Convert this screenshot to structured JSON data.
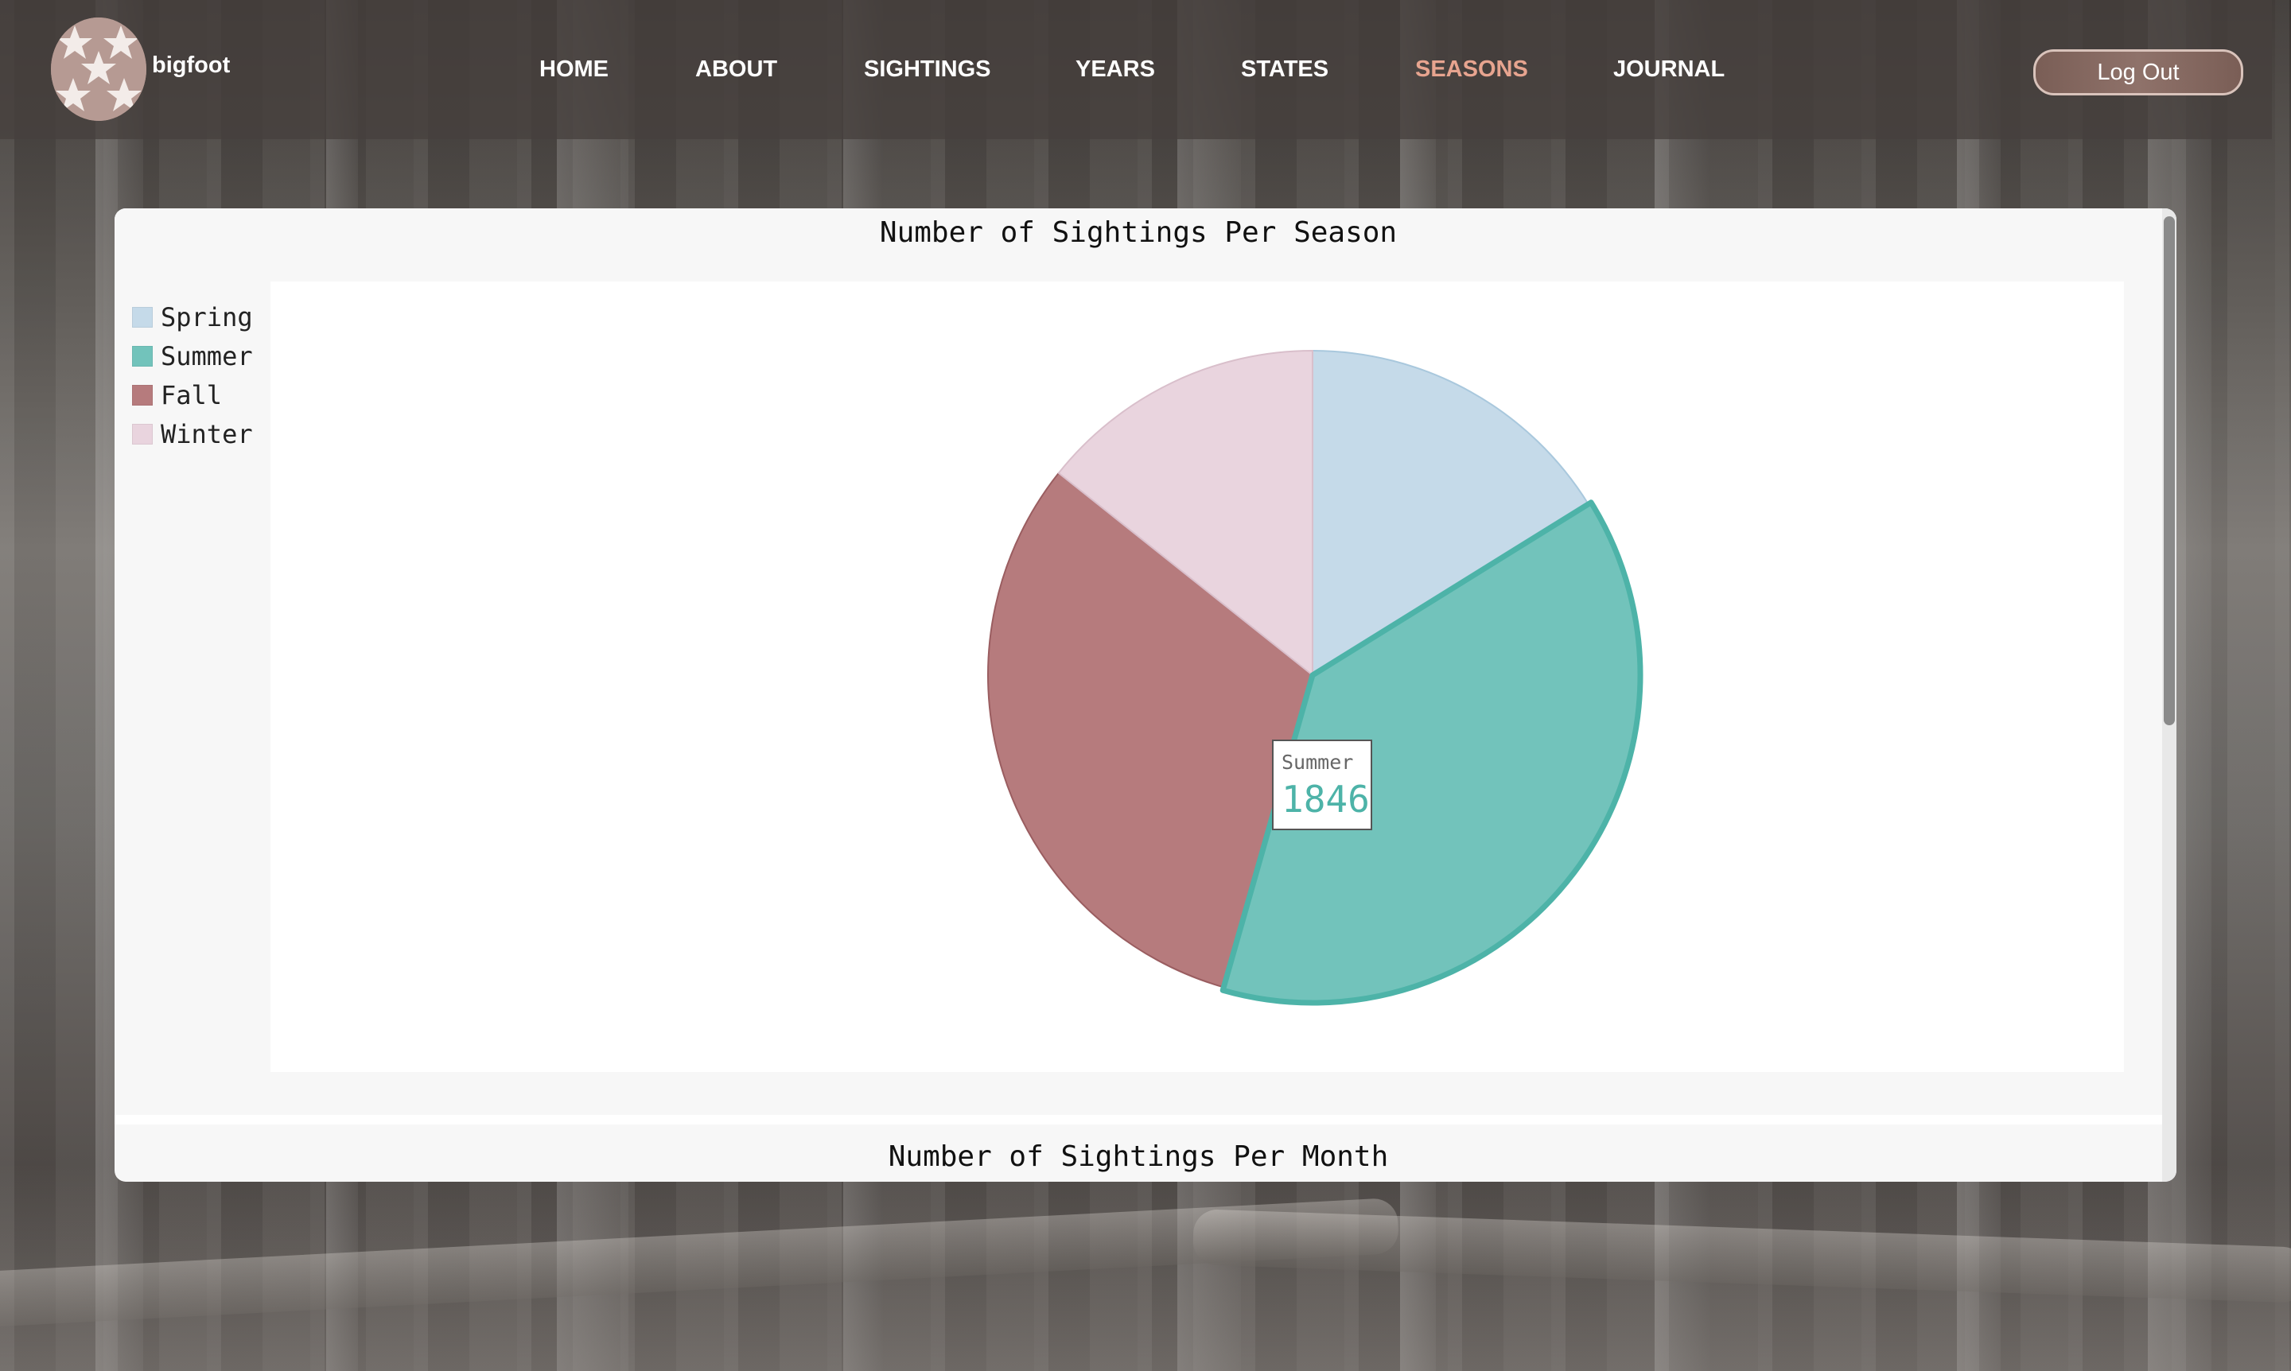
{
  "header": {
    "brand": "bigfoot",
    "logo_icon": "star-pattern-logo-icon",
    "nav": [
      {
        "label": "HOME",
        "active": false
      },
      {
        "label": "ABOUT",
        "active": false
      },
      {
        "label": "SIGHTINGS",
        "active": false
      },
      {
        "label": "YEARS",
        "active": false
      },
      {
        "label": "STATES",
        "active": false
      },
      {
        "label": "SEASONS",
        "active": true
      },
      {
        "label": "JOURNAL",
        "active": false
      }
    ],
    "logout_label": "Log Out"
  },
  "colors": {
    "active_nav": "#e7a48f",
    "spring": "#c5dae9",
    "summer": "#72c3bb",
    "fall": "#b67b7d",
    "winter": "#e9d4de"
  },
  "main": {
    "chart_title": "Number of Sightings Per Season",
    "second_chart_title": "Number of Sightings Per Month",
    "tooltip": {
      "label": "Summer",
      "value": "1846"
    }
  },
  "chart_data": {
    "type": "pie",
    "title": "Number of Sightings Per Season",
    "legend_position": "top-left",
    "highlighted": "Summer",
    "slices": [
      {
        "label": "Spring",
        "value": 780
      },
      {
        "label": "Summer",
        "value": 1846
      },
      {
        "label": "Fall",
        "value": 1510
      },
      {
        "label": "Winter",
        "value": 690
      }
    ]
  }
}
